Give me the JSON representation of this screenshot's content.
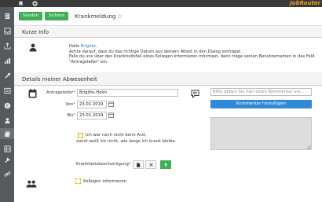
{
  "app": {
    "brand": "JobRouter"
  },
  "topbar": {
    "icons": [
      "bookmark-icon",
      "plus-icon"
    ]
  },
  "sidebar": {
    "items": [
      "document-icon",
      "inbox-icon",
      "upload-icon",
      "chart-icon",
      "tools-icon",
      "list-icon",
      "euro-icon",
      "user-icon",
      "stack-icon",
      "grid-icon",
      "wrench-icon",
      "link-icon"
    ]
  },
  "toolbar": {
    "send_label": "Senden",
    "save_label": "Sichern",
    "title": "Krankmeldung"
  },
  "colors": {
    "accent_green": "#3fae56",
    "accent_blue": "#2f89d4",
    "brand": "#f0a020",
    "required": "#d9342b",
    "checkbox_border": "#e2b318"
  },
  "info": {
    "heading": "Kurze Info",
    "greeting": "Hallo",
    "name": "Brigitte,",
    "line1": "Achte darauf, dass du das richtige Datum aus deinem Attest in den Dialog einträgst.",
    "line2": "Falls du uns über den Krankheitsfall eines Kollegen informieren möchtest, dann trage seinen Benutzernamen in das Feld \"Antragsteller\" ein."
  },
  "details": {
    "heading": "Details meiner Abwesenheit",
    "applicant_label": "Antragsteller",
    "applicant_value": "Brigitte.Holm",
    "from_label": "Von",
    "from_value": "23.01.2019",
    "to_label": "Bis",
    "to_value": "23.01.2019",
    "comment_placeholder": "Bitte geben Sie hier einen Kommentar ein.....",
    "comment_button": "Kommentar hinzufügen",
    "doctor_line1": "Ich war noch nicht beim Arzt,",
    "doctor_line2": "somit weiß ich nicht, wie lange ich krank bleibe.",
    "certificate_label": "Krankheitsbescheinigung",
    "colleagues_label": "Kollegen informieren",
    "required_mark": "*"
  }
}
